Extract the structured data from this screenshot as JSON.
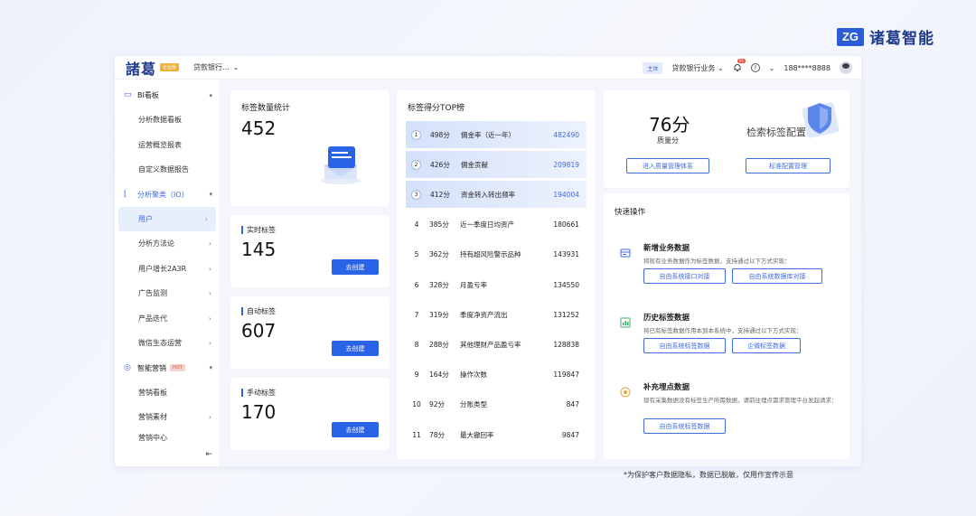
{
  "brand": {
    "mark": "ZG",
    "name": "诸葛智能"
  },
  "topbar": {
    "logo": "諸葛",
    "logo_badge": "企业版",
    "app_select": "贷款银行...",
    "main_tag": "主体",
    "business_select": "贷款银行业务",
    "bell_count": "99",
    "user": "188****8888"
  },
  "sidebar": {
    "groups": [
      {
        "label": "BI看板",
        "items": [
          "分析数据看板",
          "运营概览报表",
          "自定义数据报告"
        ]
      },
      {
        "label": "分析聚类（IO）",
        "items": [
          "用户",
          "分析方法论",
          "用户增长2A3R",
          "广告监测",
          "产品迭代",
          "微信生态运营"
        ]
      },
      {
        "label": "智能营销",
        "hot": "HOT",
        "items": [
          "营销看板",
          "营销素材",
          "营销中心"
        ]
      }
    ]
  },
  "stats": {
    "total_title": "标签数量统计",
    "total_value": "452",
    "realtime_label": "实时标签",
    "realtime_value": "145",
    "auto_label": "自动标签",
    "auto_value": "607",
    "manual_label": "手动标签",
    "manual_value": "170",
    "create_label": "去创建"
  },
  "top_list": {
    "title": "标签得分TOP榜",
    "rows": [
      {
        "rank": "1",
        "score": "498分",
        "name": "佣金率（近一年）",
        "value": "482490"
      },
      {
        "rank": "2",
        "score": "426分",
        "name": "佣金贡献",
        "value": "209819"
      },
      {
        "rank": "3",
        "score": "412分",
        "name": "资金转入转出频率",
        "value": "194004"
      },
      {
        "rank": "4",
        "score": "385分",
        "name": "近一季度日均资产",
        "value": "180661"
      },
      {
        "rank": "5",
        "score": "362分",
        "name": "持有超风险警示品种",
        "value": "143931"
      },
      {
        "rank": "6",
        "score": "328分",
        "name": "月盈亏率",
        "value": "134550"
      },
      {
        "rank": "7",
        "score": "319分",
        "name": "季度净资产流出",
        "value": "131252"
      },
      {
        "rank": "8",
        "score": "288分",
        "name": "其他理财产品盈亏率",
        "value": "128838"
      },
      {
        "rank": "9",
        "score": "164分",
        "name": "操作次数",
        "value": "119847"
      },
      {
        "rank": "10",
        "score": "92分",
        "name": "分账类型",
        "value": "847"
      },
      {
        "rank": "11",
        "score": "78分",
        "name": "最大撤回率",
        "value": "9847"
      }
    ]
  },
  "quality": {
    "score": "76分",
    "label": "质量分",
    "btn_quality": "进入质量管理体系",
    "search_title": "检索标签配置",
    "btn_standard": "标准配置管理"
  },
  "quick": {
    "title": "快速操作",
    "items": [
      {
        "title": "新增业务数据",
        "desc": "将现有业务数据作为标签数据，支持通过以下方式实现：",
        "btn1": "自由系统接口对接",
        "btn2": "自由系统数据库对接"
      },
      {
        "title": "历史标签数据",
        "desc": "将已有标签数据作用本到本系统中，支持通过以下方式实现：",
        "btn1": "自由系统标签数据",
        "btn2": "企微标签数据"
      },
      {
        "title": "补充埋点数据",
        "desc": "现有采集数据没有标签生产所需数据，请前往埋点需求管理平台发起请求：",
        "btn1": "自由系统标签数据"
      }
    ]
  },
  "footnote": "*为保护客户数据隐私，数据已脱敏，仅用作宣传示意"
}
